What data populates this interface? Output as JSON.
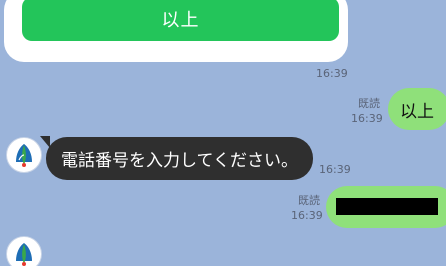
{
  "top_card": {
    "button_label": "以上",
    "time": "16:39"
  },
  "outgoing": [
    {
      "read": "既読",
      "time": "16:39",
      "text": "以上"
    },
    {
      "read": "既読",
      "time": "16:39",
      "text": ""
    }
  ],
  "incoming": [
    {
      "text": "電話番号を入力してください。",
      "time": "16:39"
    }
  ],
  "colors": {
    "background": "#9bb4da",
    "button": "#23c55a",
    "outgoing_bubble": "#8fe07a",
    "incoming_bubble": "#2f2f2f"
  },
  "avatar_icon": "app-logo-icon"
}
